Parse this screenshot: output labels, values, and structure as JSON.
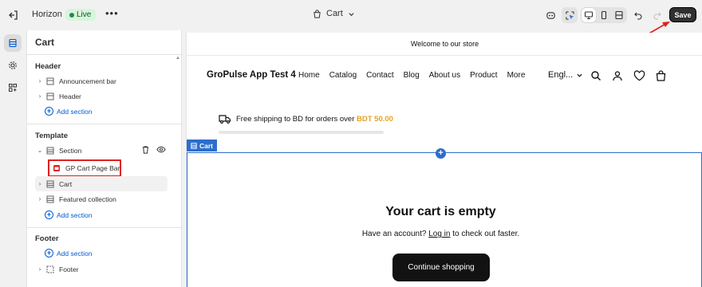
{
  "topbar": {
    "theme_name": "Horizon",
    "live_label": "Live",
    "more_label": "•••",
    "page_label": "Cart",
    "save_label": "Save"
  },
  "panel": {
    "title": "Cart",
    "header_group": {
      "title": "Header",
      "items": [
        "Announcement bar",
        "Header"
      ],
      "add_label": "Add section"
    },
    "template_group": {
      "title": "Template",
      "section_label": "Section",
      "block_label": "GP Cart Page Bar",
      "items": [
        "Cart",
        "Featured collection"
      ],
      "add_label": "Add section"
    },
    "footer_group": {
      "title": "Footer",
      "add_label": "Add section",
      "items": [
        "Footer"
      ]
    }
  },
  "preview": {
    "announcement": "Welcome to our store",
    "store_name": "GroPulse App Test 4",
    "nav": [
      "Home",
      "Catalog",
      "Contact",
      "Blog",
      "About us",
      "Product",
      "More"
    ],
    "language": "Engl...",
    "shipping_text": "Free shipping to BD for orders over",
    "shipping_amount": "BDT 50.00",
    "shipping_progress": 0,
    "cart_tag": "Cart",
    "empty_title": "Your cart is empty",
    "empty_sub_before": "Have an account?",
    "empty_sub_link": "Log in",
    "empty_sub_after": "to check out faster.",
    "continue_label": "Continue shopping"
  },
  "colors": {
    "accent_blue": "#2c6ecb",
    "highlight_red": "#e0201d",
    "shipping_amount": "#e5a220",
    "live_badge": "#d7f5d9"
  }
}
